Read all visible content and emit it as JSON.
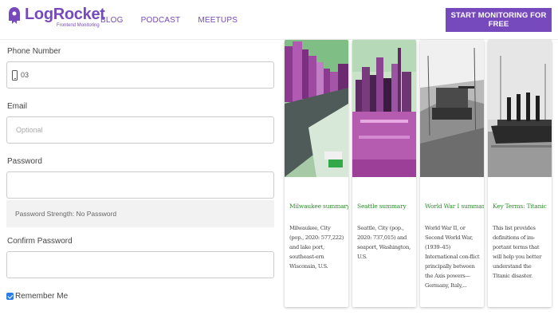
{
  "header": {
    "brand": "LogRocket",
    "brand_sub": "Frontend Monitoring",
    "nav": [
      "BLOG",
      "PODCAST",
      "MEETUPS"
    ],
    "cta": "START MONITORING FOR FREE",
    "colors": {
      "brand": "#764abc"
    }
  },
  "form": {
    "phone": {
      "label": "Phone Number",
      "value": "03"
    },
    "email": {
      "label": "Email",
      "placeholder": "Optional"
    },
    "password": {
      "label": "Password",
      "value": ""
    },
    "strength": "Password Strength: No Password",
    "confirm": {
      "label": "Confirm Password",
      "value": ""
    },
    "remember": {
      "label": "Remember Me",
      "checked": true
    }
  },
  "cards": [
    {
      "title": "Milwaukee summary",
      "text": "Milwaukee, City (pop., 2020: 577,222) and lake port, southeast-ern Wisconsin, U.S.",
      "image": "milwaukee-skyline-photo"
    },
    {
      "title": "Seattle summary",
      "text": "Seattle, City (pop., 2020: 737,015) and seaport, Washington, U.S.",
      "image": "seattle-skyline-photo"
    },
    {
      "title": "World War I summary",
      "text": "World War II, or Second World War, (1939–45) International con-flict principally between the Axis powers—Germany, Italy,...",
      "image": "war-tank-photo"
    },
    {
      "title": "Key Terms: Titanic",
      "text": "This list provides definitions of im-portant terms that will help you better understand the Titanic disaster.",
      "image": "titanic-ship-photo"
    }
  ]
}
